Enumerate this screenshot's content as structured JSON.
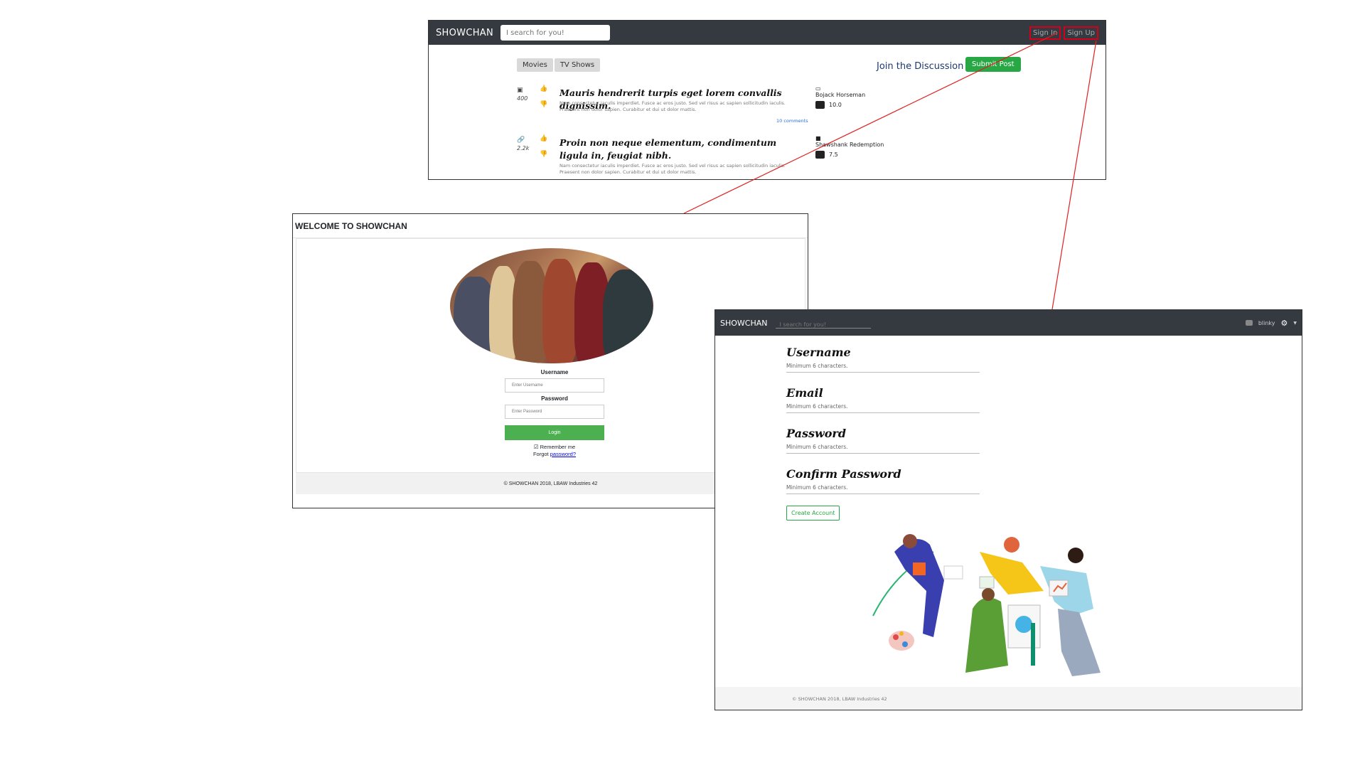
{
  "main": {
    "brand": "SHOWCHAN",
    "search_placeholder": "I search for you!",
    "nav": {
      "signin": "Sign In",
      "signup": "Sign Up"
    },
    "tabs": [
      {
        "label": "Movies"
      },
      {
        "label": "TV Shows"
      }
    ],
    "join": "Join the Discussion",
    "submit": "Submit Post",
    "posts": [
      {
        "type_icon": "image-icon",
        "count": "400",
        "title": "Mauris hendrerit turpis eget lorem convallis dignissim.",
        "body": "Nam consectetur iaculis imperdiet. Fusce ac eros justo. Sed vel risus ac sapien sollicitudin iaculis. Praesent non dolor sapien. Curabitur et dui ut dolor mattis.",
        "comments": "10 comments",
        "show": "Bojack Horseman",
        "rating": "10.0"
      },
      {
        "type_icon": "link-icon",
        "count": "2.2k",
        "title": "Proin non neque elementum, condimentum ligula in, feugiat nibh.",
        "body": "Nam consectetur iaculis imperdiet. Fusce ac eros justo. Sed vel risus ac sapien sollicitudin iaculis. Praesent non dolor sapien. Curabitur et dui ut dolor mattis.",
        "comments": "",
        "show": "Shawshank Redemption",
        "rating": "7.5"
      }
    ]
  },
  "login": {
    "header": "WELCOME TO SHOWCHAN",
    "username_label": "Username",
    "username_placeholder": "Enter Username",
    "password_label": "Password",
    "password_placeholder": "Enter Password",
    "button": "Login",
    "remember": "Remember me",
    "forgot_prefix": "Forgot ",
    "forgot_link": "password?",
    "footer": "© SHOWCHAN 2018, LBAW Industries 42"
  },
  "signup": {
    "brand": "SHOWCHAN",
    "search_placeholder": "I search for you!",
    "user": "blinky",
    "fields": [
      {
        "title": "Username",
        "hint": "Minimum 6 characters."
      },
      {
        "title": "Email",
        "hint": "Minimum 6 characters."
      },
      {
        "title": "Password",
        "hint": "Minimum 6 characters."
      },
      {
        "title": "Confirm Password",
        "hint": "Minimum 6 characters."
      }
    ],
    "button": "Create Account",
    "footer": "© SHOWCHAN 2018, LBAW Industries 42"
  },
  "colors": {
    "navbar": "#343a40",
    "primary_green": "#28a745",
    "login_green": "#4caf50",
    "highlight_red": "#d0021b",
    "link_blue": "#2a6fdb"
  }
}
